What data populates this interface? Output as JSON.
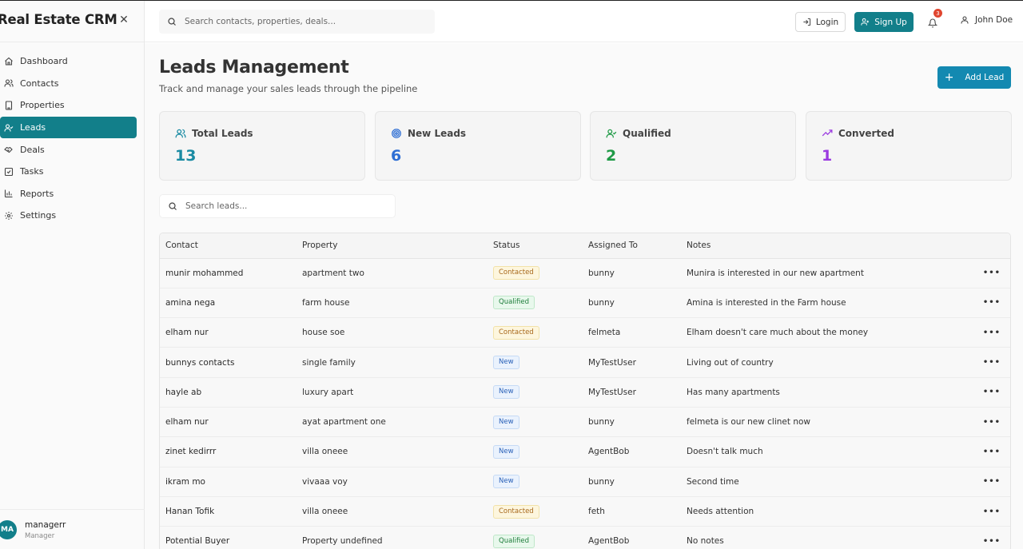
{
  "app": {
    "title": "Real Estate CRM"
  },
  "sidebar": {
    "items": [
      {
        "label": "Dashboard",
        "icon": "home-icon",
        "active": false
      },
      {
        "label": "Contacts",
        "icon": "users-icon",
        "active": false
      },
      {
        "label": "Properties",
        "icon": "building-icon",
        "active": false
      },
      {
        "label": "Leads",
        "icon": "user-check-icon",
        "active": true
      },
      {
        "label": "Deals",
        "icon": "handshake-icon",
        "active": false
      },
      {
        "label": "Tasks",
        "icon": "checkbox-icon",
        "active": false
      },
      {
        "label": "Reports",
        "icon": "bar-chart-icon",
        "active": false
      },
      {
        "label": "Settings",
        "icon": "gear-icon",
        "active": false
      }
    ],
    "user": {
      "initials": "MA",
      "name": "managerr",
      "role": "Manager"
    }
  },
  "topbar": {
    "search_placeholder": "Search contacts, properties, deals...",
    "login_label": "Login",
    "signup_label": "Sign Up",
    "notification_count": "3",
    "user_name": "John Doe"
  },
  "page": {
    "title": "Leads Management",
    "subtitle": "Track and manage your sales leads through the pipeline",
    "add_label": "Add Lead"
  },
  "stats": [
    {
      "label": "Total Leads",
      "value": "13",
      "color": "#1a8ba3",
      "icon": "users-icon"
    },
    {
      "label": "New Leads",
      "value": "6",
      "color": "#2f6fd4",
      "icon": "target-icon"
    },
    {
      "label": "Qualified",
      "value": "2",
      "color": "#1f9a46",
      "icon": "user-check-icon"
    },
    {
      "label": "Converted",
      "value": "1",
      "color": "#9b3be0",
      "icon": "trending-up-icon"
    }
  ],
  "leads_search_placeholder": "Search leads...",
  "table": {
    "headers": [
      "Contact",
      "Property",
      "Status",
      "Assigned To",
      "Notes"
    ],
    "rows": [
      {
        "contact": "munir mohammed",
        "property": "apartment two",
        "status": "Contacted",
        "assigned": "bunny",
        "notes": "Munira is interested in our new apartment"
      },
      {
        "contact": "amina nega",
        "property": "farm house",
        "status": "Qualified",
        "assigned": "bunny",
        "notes": "Amina is interested in the Farm house"
      },
      {
        "contact": "elham nur",
        "property": "house soe",
        "status": "Contacted",
        "assigned": "felmeta",
        "notes": "Elham doesn't care much about the money"
      },
      {
        "contact": "bunnys contacts",
        "property": "single family",
        "status": "New",
        "assigned": "MyTestUser",
        "notes": "Living out of country"
      },
      {
        "contact": "hayle ab",
        "property": "luxury apart",
        "status": "New",
        "assigned": "MyTestUser",
        "notes": "Has many apartments"
      },
      {
        "contact": "elham nur",
        "property": "ayat apartment one",
        "status": "New",
        "assigned": "bunny",
        "notes": "felmeta is our new clinet now"
      },
      {
        "contact": "zinet kedirrr",
        "property": "villa oneee",
        "status": "New",
        "assigned": "AgentBob",
        "notes": "Doesn't talk much"
      },
      {
        "contact": "ikram mo",
        "property": "vivaaa voy",
        "status": "New",
        "assigned": "bunny",
        "notes": "Second time"
      },
      {
        "contact": "Hanan Tofik",
        "property": "villa oneee",
        "status": "Contacted",
        "assigned": "feth",
        "notes": "Needs attention"
      },
      {
        "contact": "Potential Buyer",
        "property": "Property undefined",
        "status": "Qualified",
        "assigned": "AgentBob",
        "notes": "No notes"
      }
    ]
  }
}
